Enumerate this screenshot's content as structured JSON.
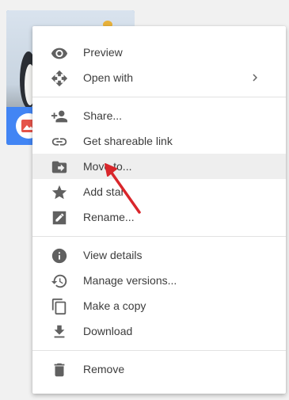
{
  "menu": {
    "items": [
      {
        "label": "Preview",
        "icon": "eye-icon"
      },
      {
        "label": "Open with",
        "icon": "move-arrows-icon"
      },
      {
        "label": "Share...",
        "icon": "person-add-icon"
      },
      {
        "label": "Get shareable link",
        "icon": "link-icon"
      },
      {
        "label": "Move to...",
        "icon": "folder-move-icon"
      },
      {
        "label": "Add star",
        "icon": "star-icon"
      },
      {
        "label": "Rename...",
        "icon": "pencil-icon"
      },
      {
        "label": "View details",
        "icon": "info-icon"
      },
      {
        "label": "Manage versions...",
        "icon": "history-icon"
      },
      {
        "label": "Make a copy",
        "icon": "copy-icon"
      },
      {
        "label": "Download",
        "icon": "download-icon"
      },
      {
        "label": "Remove",
        "icon": "trash-icon"
      }
    ],
    "highlighted_item": "Move to..."
  },
  "colors": {
    "drive_blue": "#4285f4",
    "image_badge_red": "#e5544a",
    "annotation_arrow": "#d9262b",
    "icon_gray": "#606060",
    "highlight_row": "#eeeeee"
  }
}
